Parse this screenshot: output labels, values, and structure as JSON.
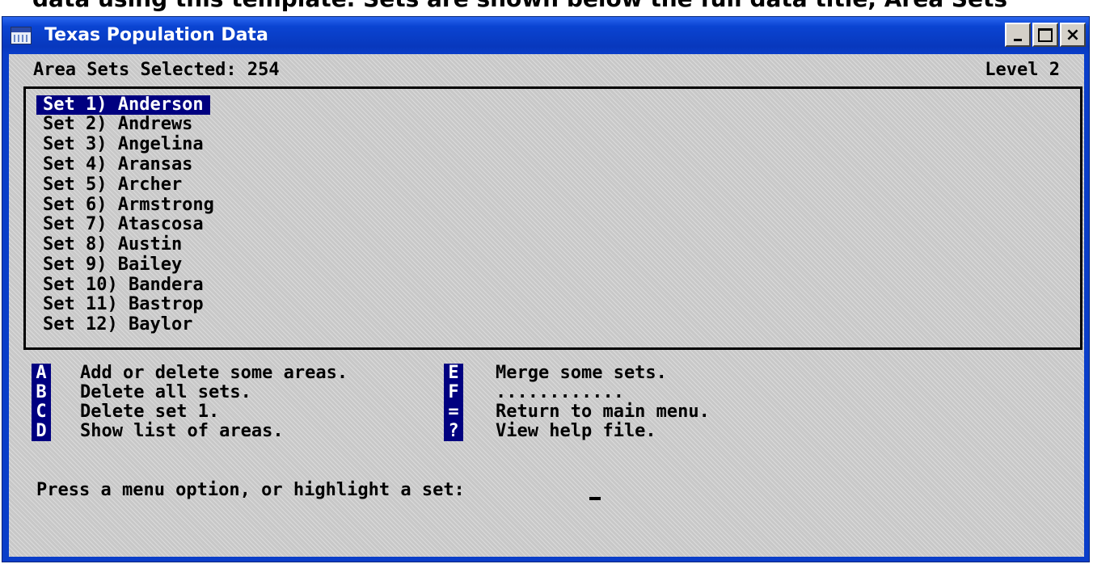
{
  "page_top_text": "data using this template. Sets are shown below the full data title, Area Sets",
  "window": {
    "title": "Texas Population Data",
    "buttons": {
      "minimize": "minimize",
      "maximize": "maximize",
      "close": "×"
    }
  },
  "header": {
    "area_sets": "Area Sets Selected: 254",
    "level": "Level 2"
  },
  "sets": [
    {
      "label": "Set 1) Anderson",
      "selected": true
    },
    {
      "label": "Set 2) Andrews"
    },
    {
      "label": "Set 3) Angelina"
    },
    {
      "label": "Set 4) Aransas"
    },
    {
      "label": "Set 5) Archer"
    },
    {
      "label": "Set 6) Armstrong"
    },
    {
      "label": "Set 7) Atascosa"
    },
    {
      "label": "Set 8) Austin"
    },
    {
      "label": "Set 9) Bailey"
    },
    {
      "label": "Set 10) Bandera"
    },
    {
      "label": "Set 11) Bastrop"
    },
    {
      "label": "Set 12) Baylor"
    }
  ],
  "menu_left": [
    {
      "key": "A",
      "text": "Add or delete some areas."
    },
    {
      "key": "B",
      "text": "Delete all sets."
    },
    {
      "key": "C",
      "text": "Delete set 1."
    },
    {
      "key": "D",
      "text": "Show list of areas."
    }
  ],
  "menu_right": [
    {
      "key": "E",
      "text": "Merge some sets."
    },
    {
      "key": "F",
      "text": "............"
    },
    {
      "key": "=",
      "text": "Return to main menu."
    },
    {
      "key": "?",
      "text": "View help file."
    }
  ],
  "prompt": "Press a menu option, or highlight a set:"
}
